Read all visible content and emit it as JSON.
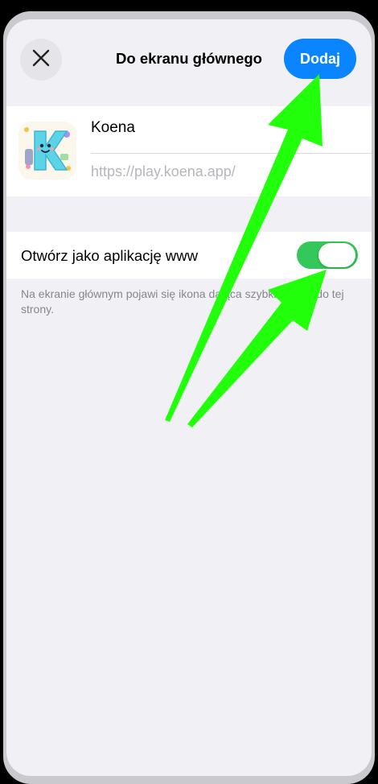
{
  "header": {
    "title": "Do ekranu głównego",
    "close_icon": "close-icon",
    "add_label": "Dodaj",
    "add_color": "#0a84ff"
  },
  "app": {
    "name": "Koena",
    "url": "https://play.koena.app/",
    "icon": "koena-app-icon"
  },
  "toggle": {
    "label": "Otwórz jako aplikację www",
    "on": true,
    "color": "#34c759"
  },
  "footnote": "Na ekranie głównym pojawi się ikona dająca szybki dostęp do tej strony.",
  "annotation": {
    "arrow_color": "#22ff0a",
    "arrows": [
      "arrow-to-add-button",
      "arrow-to-toggle"
    ]
  }
}
